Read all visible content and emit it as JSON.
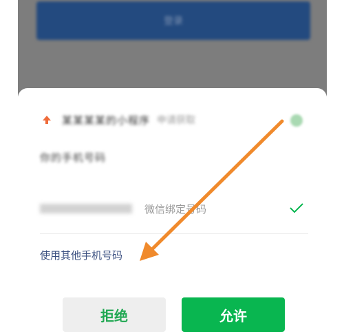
{
  "background_page": {
    "button_label": "登录"
  },
  "sheet": {
    "app_name": "某某某某的小程序",
    "app_desc": "申请获取",
    "subtitle": "你的手机号码",
    "phone": {
      "number": "",
      "label": "微信绑定号码",
      "selected": true
    },
    "other_phone_link": "使用其他手机号码",
    "reject_label": "拒绝",
    "allow_label": "允许"
  },
  "colors": {
    "accent_green": "#09b650",
    "reject_text": "#21a853",
    "link_blue": "#3a4f80",
    "annotation_arrow": "#f08a2c",
    "app_icon": "#ef6b3a"
  },
  "icons": {
    "app": "app-logo-icon",
    "info": "info-icon",
    "check": "check-icon",
    "annotation": "arrow-annotation"
  }
}
